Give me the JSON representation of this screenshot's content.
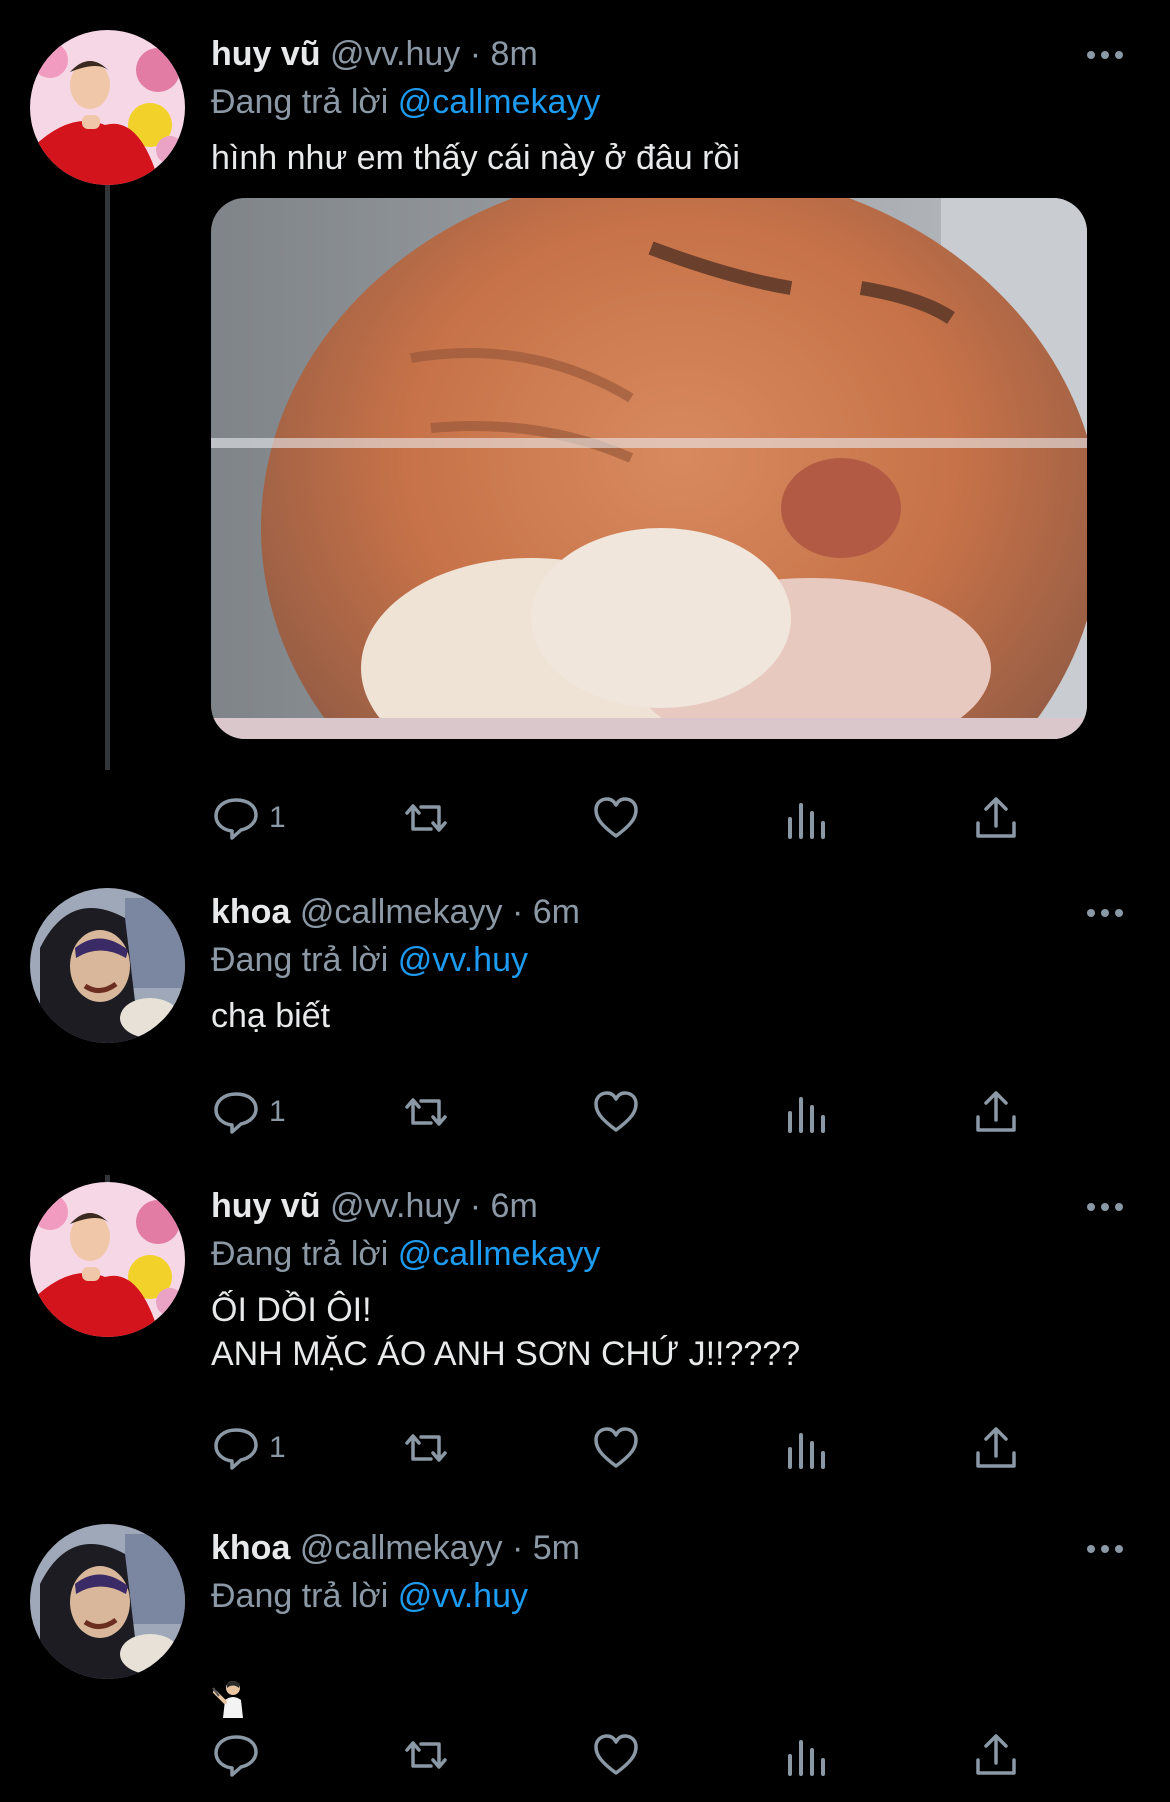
{
  "colors": {
    "background": "#000000",
    "text": "#e7e9ea",
    "muted": "#8b98a5",
    "link": "#1d9bf0",
    "thread_line": "#333639"
  },
  "reply_prefix": "Đang trả lời",
  "tweets": [
    {
      "name": "huy vũ",
      "handle": "@vv.huy",
      "separator": "·",
      "time": "8m",
      "reply_to": "@callmekayy",
      "text": "hình như em thấy cái này ở đâu rồi",
      "media": "orange-cat-closeup",
      "reply_count": "1",
      "avatar": "red-shirt-flowers-avatar"
    },
    {
      "name": "khoa",
      "handle": "@callmekayy",
      "separator": "·",
      "time": "6m",
      "reply_to": "@vv.huy",
      "text": "chạ biết",
      "reply_count": "1",
      "avatar": "hooded-person-avatar"
    },
    {
      "name": "huy vũ",
      "handle": "@vv.huy",
      "separator": "·",
      "time": "6m",
      "reply_to": "@callmekayy",
      "text": "ỐI DỒI ÔI!\nANH MẶC ÁO ANH SƠN CHỨ J!!????",
      "reply_count": "1",
      "avatar": "red-shirt-flowers-avatar"
    },
    {
      "name": "khoa",
      "handle": "@callmekayy",
      "separator": "·",
      "time": "5m",
      "reply_to": "@vv.huy",
      "text": "",
      "emoji": "person-gesturing-emoji",
      "reply_count": "",
      "avatar": "hooded-person-avatar"
    }
  ],
  "icons": [
    "reply-icon",
    "retweet-icon",
    "like-icon",
    "views-icon",
    "share-icon",
    "more-icon"
  ]
}
